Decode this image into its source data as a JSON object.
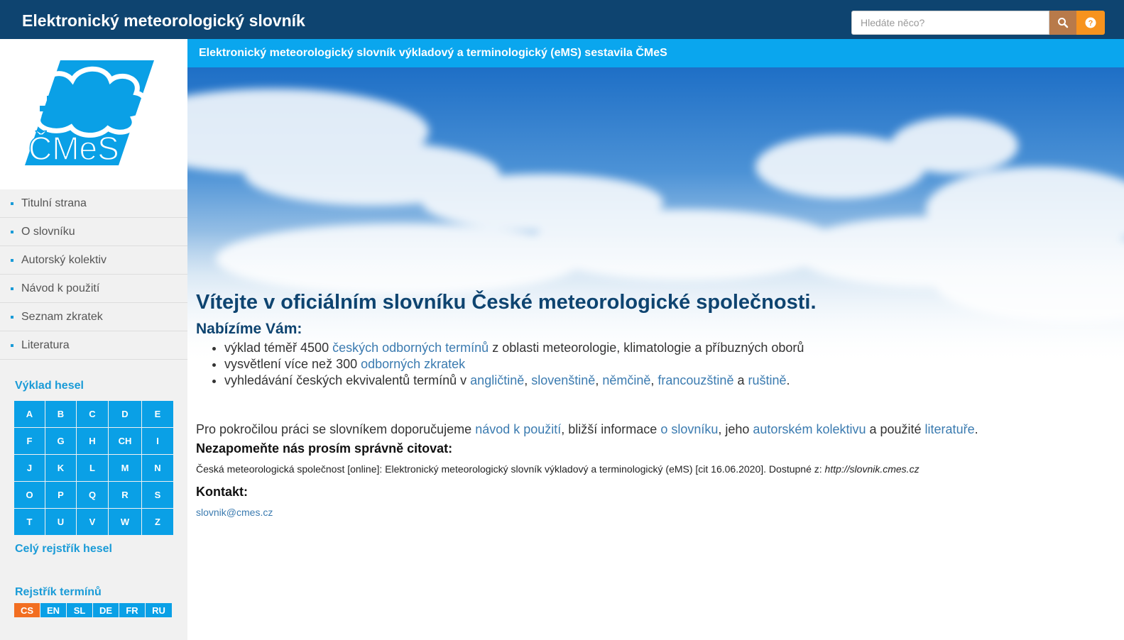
{
  "header": {
    "title": "Elektronický meteorologický slovník",
    "search_placeholder": "Hledáte něco?",
    "search_icon": "search-icon",
    "help_icon": "question-circle-icon"
  },
  "subheader": {
    "text": "Elektronický meteorologický slovník výkladový a terminologický (eMS) sestavila ČMeS"
  },
  "logo": {
    "text": "ČMeS"
  },
  "nav": {
    "items": [
      "Titulní strana",
      "O slovníku",
      "Autorský kolektiv",
      "Návod k použití",
      "Seznam zkratek",
      "Literatura"
    ]
  },
  "sidebar": {
    "vyklad_heading": "Výklad hesel",
    "letters": [
      "A",
      "B",
      "C",
      "D",
      "E",
      "F",
      "G",
      "H",
      "CH",
      "I",
      "J",
      "K",
      "L",
      "M",
      "N",
      "O",
      "P",
      "Q",
      "R",
      "S",
      "T",
      "U",
      "V",
      "W",
      "Z"
    ],
    "full_index": "Celý rejstřík hesel",
    "terms_heading": "Rejstřík termínů",
    "languages": [
      "CS",
      "EN",
      "SL",
      "DE",
      "FR",
      "RU"
    ],
    "active_language": "CS"
  },
  "main": {
    "welcome": "Vítejte v oficiálním slovníku České meteorologické společnosti.",
    "offer_heading": "Nabízíme Vám:",
    "offer1": {
      "a": "výklad téměř 4500 ",
      "link": "českých odborných termínů",
      "b": " z oblasti meteorologie, klimatologie a příbuzných oborů"
    },
    "offer2": {
      "a": "vysvětlení více než 300 ",
      "link": "odborných zkratek"
    },
    "offer3": {
      "a": "vyhledávání českých ekvivalentů termínů v ",
      "en": "angličtině",
      "sep1": ", ",
      "sk": "slovenštině",
      "sep2": ", ",
      "de": "němčině",
      "sep3": ", ",
      "fr": "francouzštině",
      "and": " a ",
      "ru": "ruštině",
      "end": "."
    },
    "para": {
      "a": "Pro pokročilou práci se slovníkem doporučujeme ",
      "link1": "návod k použití",
      "b": ", bližší informace ",
      "link2": "o slovníku",
      "c": ", jeho ",
      "link3": "autorském kolektivu",
      "d": " a použité ",
      "link4": "literatuře",
      "e": "."
    },
    "cite_heading": "Nezapomeňte nás prosím správně citovat:",
    "citation": "Česká meteorologická společnost [online]: Elektronický meteorologický slovník výkladový a terminologický (eMS) [cit 16.06.2020]. Dostupné z: ",
    "citation_url": "http://slovnik.cmes.cz",
    "contact_heading": "Kontakt:",
    "email": "slovnik@cmes.cz"
  },
  "colors": {
    "topbar": "#0e4470",
    "subbar": "#0aa6ee",
    "accent": "#1a9bd7",
    "active_lang": "#f26e21",
    "help_button": "#f7931e"
  }
}
